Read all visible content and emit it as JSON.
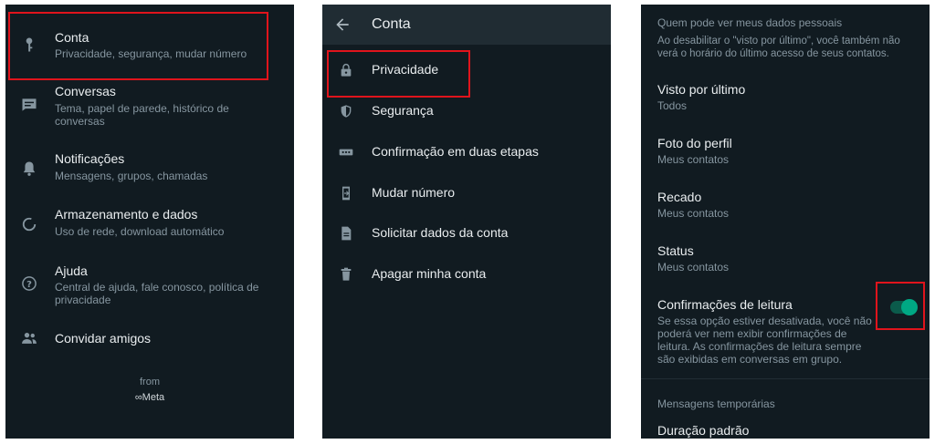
{
  "panel1": {
    "items": [
      {
        "title": "Conta",
        "subtitle": "Privacidade, segurança, mudar número",
        "icon": "key-icon"
      },
      {
        "title": "Conversas",
        "subtitle": "Tema, papel de parede, histórico de conversas",
        "icon": "chat-icon"
      },
      {
        "title": "Notificações",
        "subtitle": "Mensagens, grupos, chamadas",
        "icon": "bell-icon"
      },
      {
        "title": "Armazenamento e dados",
        "subtitle": "Uso de rede, download automático",
        "icon": "storage-circle-icon"
      },
      {
        "title": "Ajuda",
        "subtitle": "Central de ajuda, fale conosco, política de privacidade",
        "icon": "help-icon"
      },
      {
        "title": "Convidar amigos",
        "subtitle": "",
        "icon": "people-icon"
      }
    ],
    "footer_from": "from",
    "footer_brand": "∞Meta"
  },
  "panel2": {
    "header_title": "Conta",
    "items": [
      {
        "title": "Privacidade",
        "icon": "lock-icon"
      },
      {
        "title": "Segurança",
        "icon": "shield-icon"
      },
      {
        "title": "Confirmação em duas etapas",
        "icon": "dots-icon"
      },
      {
        "title": "Mudar número",
        "icon": "phone-change-icon"
      },
      {
        "title": "Solicitar dados da conta",
        "icon": "document-icon"
      },
      {
        "title": "Apagar minha conta",
        "icon": "trash-icon"
      }
    ]
  },
  "panel3": {
    "section_title": "Quem pode ver meus dados pessoais",
    "section_note": "Ao desabilitar o \"visto por último\", você também não verá o horário do último acesso de seus contatos.",
    "items": [
      {
        "title": "Visto por último",
        "value": "Todos"
      },
      {
        "title": "Foto do perfil",
        "value": "Meus contatos"
      },
      {
        "title": "Recado",
        "value": "Meus contatos"
      },
      {
        "title": "Status",
        "value": "Meus contatos"
      },
      {
        "title": "Confirmações de leitura",
        "value": "Se essa opção estiver desativada, você não poderá ver nem exibir confirmações de leitura. As confirmações de leitura sempre são exibidas em conversas em grupo.",
        "toggle_on": true
      }
    ],
    "section2_title": "Mensagens temporárias",
    "section2_item": "Duração padrão"
  },
  "colors": {
    "highlight": "#e0141c",
    "accent": "#00a884",
    "background": "#111b21"
  }
}
